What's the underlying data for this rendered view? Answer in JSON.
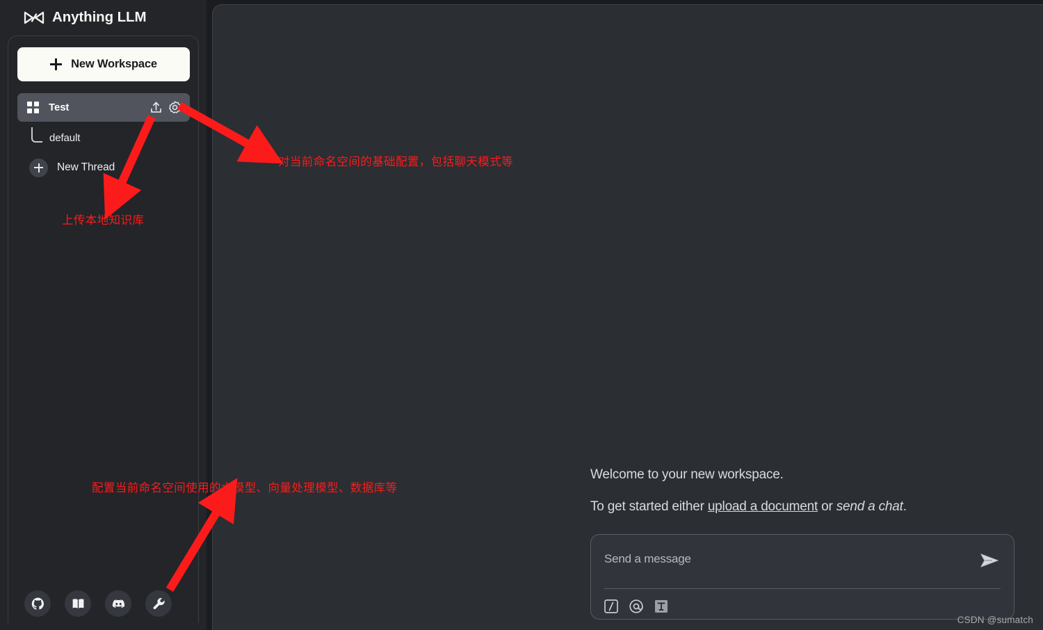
{
  "app": {
    "brand": "Anything LLM",
    "logo_icon": "anythingllm-bowtie-logo"
  },
  "sidebar": {
    "new_workspace_button": "New Workspace",
    "workspace": {
      "name": "Test",
      "grid_icon": "grid-squares-icon",
      "upload_icon": "upload-icon",
      "settings_icon": "gear-icon"
    },
    "threads": [
      {
        "label": "default",
        "type": "thread"
      },
      {
        "label": "New Thread",
        "type": "new-thread"
      }
    ],
    "footer_buttons": [
      {
        "name": "github-icon",
        "label": "GitHub"
      },
      {
        "name": "book-icon",
        "label": "Docs"
      },
      {
        "name": "discord-icon",
        "label": "Discord"
      },
      {
        "name": "wrench-icon",
        "label": "Settings"
      }
    ]
  },
  "main": {
    "welcome_line1": "Welcome to your new workspace.",
    "welcome_line2_prefix": "To get started either ",
    "welcome_line2_link": "upload a document",
    "welcome_line2_middle": " or ",
    "welcome_line2_italic": "send a chat",
    "welcome_line2_suffix": ".",
    "composer": {
      "placeholder": "Send a message",
      "send_icon": "send-paper-plane-icon",
      "tools": [
        {
          "name": "slash-command-icon",
          "glyph": "/"
        },
        {
          "name": "at-mention-icon",
          "glyph": "@"
        },
        {
          "name": "text-format-icon",
          "glyph": "T"
        }
      ]
    }
  },
  "annotations": [
    {
      "id": "gear",
      "text": "对当前命名空间的基础配置，包括聊天模式等",
      "color": "#fc1b1b",
      "points_to": "gear-icon"
    },
    {
      "id": "upload",
      "text": "上传本地知识库",
      "color": "#fc1b1b",
      "points_to": "upload-icon"
    },
    {
      "id": "wrench",
      "text": "配置当前命名空间使用的大模型、向量处理模型、数据库等",
      "color": "#fc1b1b",
      "points_to": "wrench-icon"
    }
  ],
  "watermark": "CSDN @sumatch",
  "colors": {
    "sidebar_bg": "#232529",
    "main_bg": "#2b2e33",
    "page_bg": "#1b1c1f",
    "accent_button": "#fbfbf5",
    "annotation_red": "#fc1b1b",
    "workspace_row_active": "#51545c"
  }
}
